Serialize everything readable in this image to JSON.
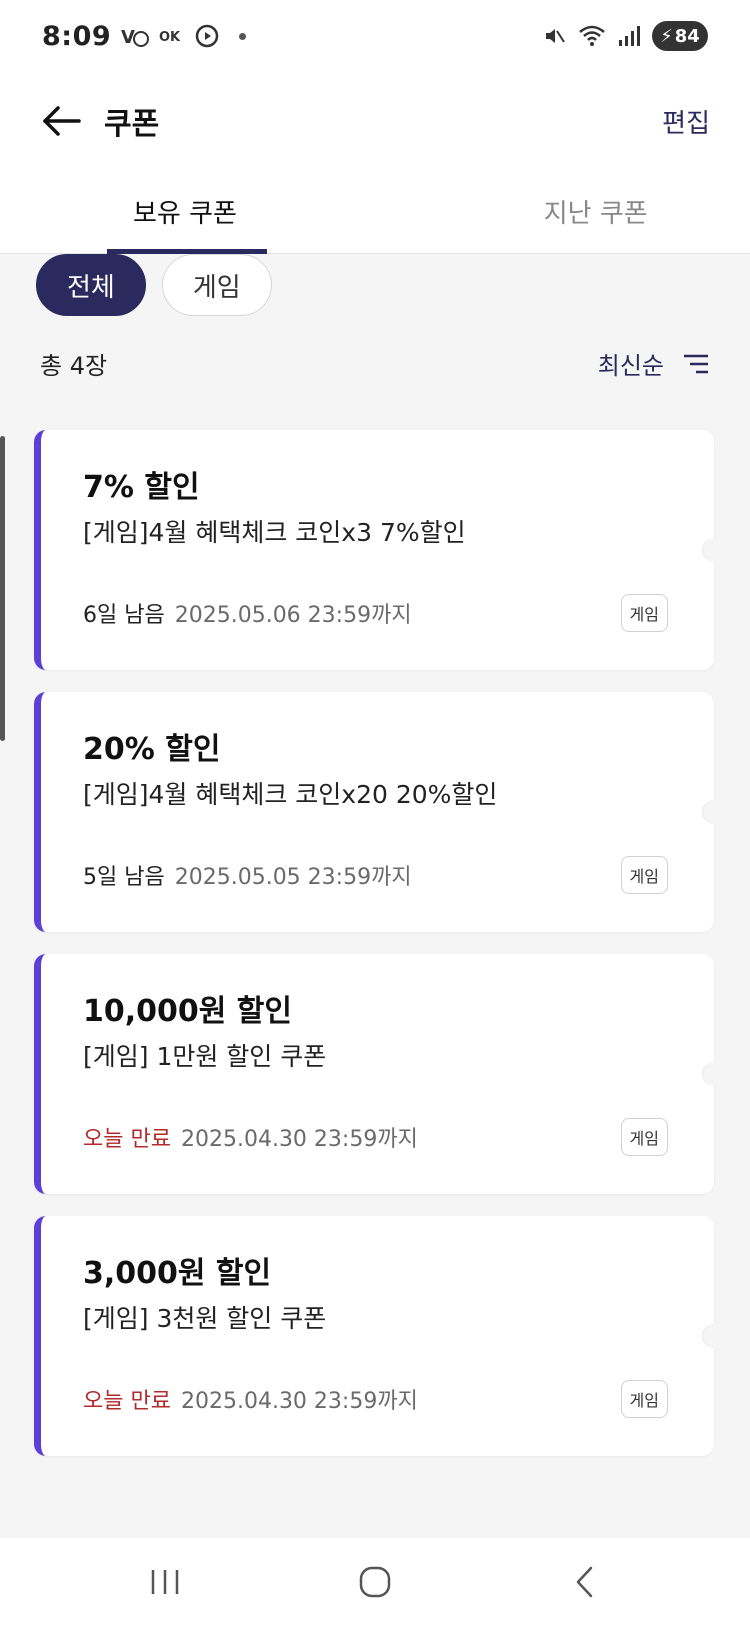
{
  "status_bar": {
    "time": "8:09",
    "battery": "84",
    "left_icons": [
      "vi-icon",
      "ok-icon",
      "play-icon",
      "dot"
    ],
    "right_icons": [
      "mute-icon",
      "wifi-icon",
      "signal-icon"
    ]
  },
  "header": {
    "title": "쿠폰",
    "edit_label": "편집"
  },
  "tabs": [
    {
      "label": "보유 쿠폰",
      "active": true
    },
    {
      "label": "지난 쿠폰",
      "active": false
    }
  ],
  "filters": [
    {
      "label": "전체",
      "active": true
    },
    {
      "label": "게임",
      "active": false
    }
  ],
  "list": {
    "total": "총 4장",
    "sort_label": "최신순"
  },
  "coupons": [
    {
      "title": "7% 할인",
      "desc": "[게임]4월 혜택체크 코인x3 7%할인",
      "remain": "6일 남음",
      "expiry": "2025.05.06 23:59까지",
      "badge": "게임",
      "urgent": false
    },
    {
      "title": "20% 할인",
      "desc": "[게임]4월 혜택체크 코인x20 20%할인",
      "remain": "5일 남음",
      "expiry": "2025.05.05 23:59까지",
      "badge": "게임",
      "urgent": false
    },
    {
      "title": "10,000원 할인",
      "desc": "[게임] 1만원 할인 쿠폰",
      "remain": "오늘 만료",
      "expiry": "2025.04.30 23:59까지",
      "badge": "게임",
      "urgent": true
    },
    {
      "title": "3,000원 할인",
      "desc": "[게임] 3천원 할인 쿠폰",
      "remain": "오늘 만료",
      "expiry": "2025.04.30 23:59까지",
      "badge": "게임",
      "urgent": true
    }
  ],
  "colors": {
    "accent": "#2b2a5e",
    "card_stripe": "#5b3fd6",
    "urgent": "#b22a2a",
    "background": "#f5f5f5"
  },
  "nav_icons": [
    "recent-apps-icon",
    "home-icon",
    "back-icon"
  ]
}
